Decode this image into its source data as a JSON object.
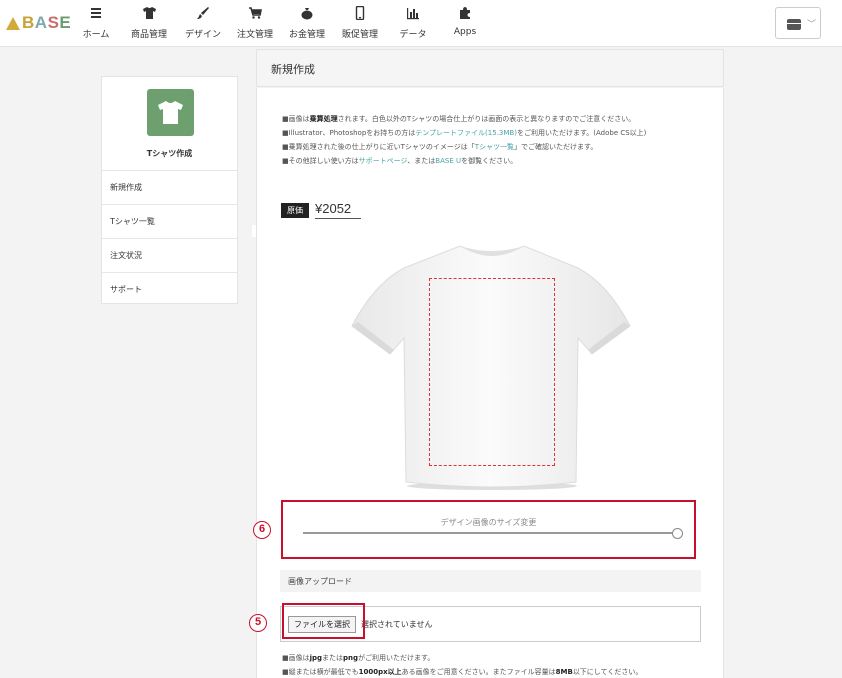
{
  "header": {
    "logo": "BASE",
    "nav": [
      {
        "label": "ホーム",
        "icon": "list-icon"
      },
      {
        "label": "商品管理",
        "icon": "tshirt-icon"
      },
      {
        "label": "デザイン",
        "icon": "brush-icon"
      },
      {
        "label": "注文管理",
        "icon": "cart-icon"
      },
      {
        "label": "お金管理",
        "icon": "money-bag-icon"
      },
      {
        "label": "販促管理",
        "icon": "smartphone-icon"
      },
      {
        "label": "データ",
        "icon": "bar-chart-icon"
      },
      {
        "label": "Apps",
        "icon": "puzzle-icon"
      }
    ]
  },
  "sidebar": {
    "app_title": "Tシャツ作成",
    "items": [
      {
        "label": "新規作成"
      },
      {
        "label": "Tシャツ一覧"
      },
      {
        "label": "注文状況"
      },
      {
        "label": "サポート"
      }
    ]
  },
  "main": {
    "title": "新規作成",
    "notices": {
      "n1_a": "画像は",
      "n1_b": "乗算処理",
      "n1_c": "されます。白色以外のTシャツの場合仕上がりは画面の表示と異なりますのでご注意ください。",
      "n2_a": "Illustrator、Photoshopをお持ちの方は",
      "n2_link": "テンプレートファイル(15.3MB)",
      "n2_c": "をご利用いただけます。(Adobe CS以上)",
      "n3_a": "乗算処理された後の仕上がりに近いTシャツのイメージは「",
      "n3_link": "Tシャツ一覧",
      "n3_c": "」でご確認いただけます。",
      "n4_a": "その他詳しい使い方は",
      "n4_link1": "サポートページ",
      "n4_b": "、または",
      "n4_link2": "BASE U",
      "n4_c": "を御覧ください。"
    },
    "price_label": "原価",
    "price_value": "¥2052",
    "slider_label": "デザイン画像のサイズ変更",
    "slider_level": 1.0,
    "upload_title": "画像アップロード",
    "file_button": "ファイルを選択",
    "file_status": "選択されていません",
    "foot": {
      "f1_a": "画像は",
      "f1_b": "jpg",
      "f1_c": "または",
      "f1_d": "png",
      "f1_e": "がご利用いただけます。",
      "f2_a": "縦または横が最低でも",
      "f2_b": "1000px以上",
      "f2_c": "ある画像をご用意ください。またファイル容量は",
      "f2_d": "8MB",
      "f2_e": "以下にしてください。"
    }
  },
  "annotations": {
    "slider_step": "6",
    "upload_step": "5",
    "highlight_color": "#c8102e"
  },
  "colors": {
    "accent_green": "#6ea06f",
    "link": "#4aa3a3"
  }
}
